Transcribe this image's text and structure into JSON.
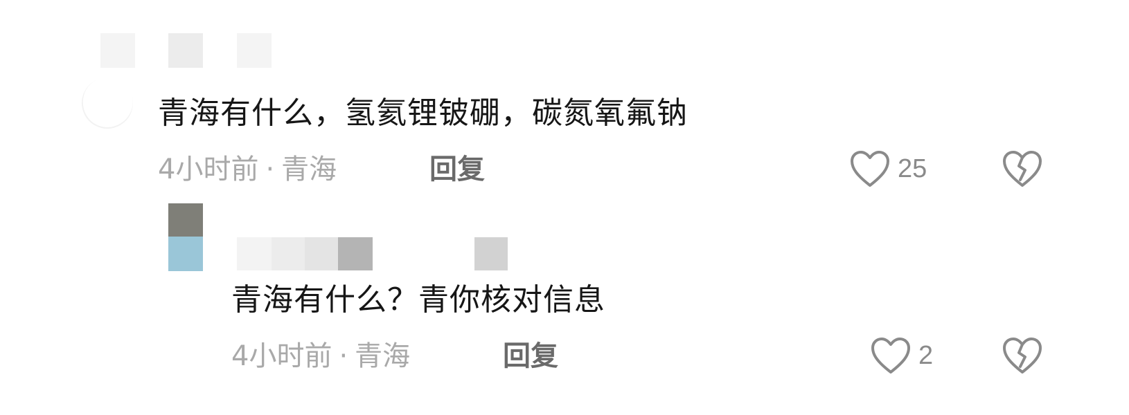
{
  "comments": [
    {
      "text": "青海有什么，氢氦锂铍硼，碳氮氧氟钠",
      "time": "4小时前",
      "location": "青海",
      "separator": "·",
      "reply_label": "回复",
      "likes": "25"
    },
    {
      "text": "青海有什么？青你核对信息",
      "time": "4小时前",
      "location": "青海",
      "separator": "·",
      "reply_label": "回复",
      "likes": "2"
    }
  ],
  "icons": {
    "like": "heart-outline-icon",
    "dislike": "broken-heart-icon"
  },
  "colors": {
    "text": "#161616",
    "meta": "#a9a9a9",
    "reply": "#6a6a6a",
    "icon": "#8a8a8a",
    "avatar_top": "#7f7f78",
    "avatar_bottom": "#9ac6d8"
  }
}
